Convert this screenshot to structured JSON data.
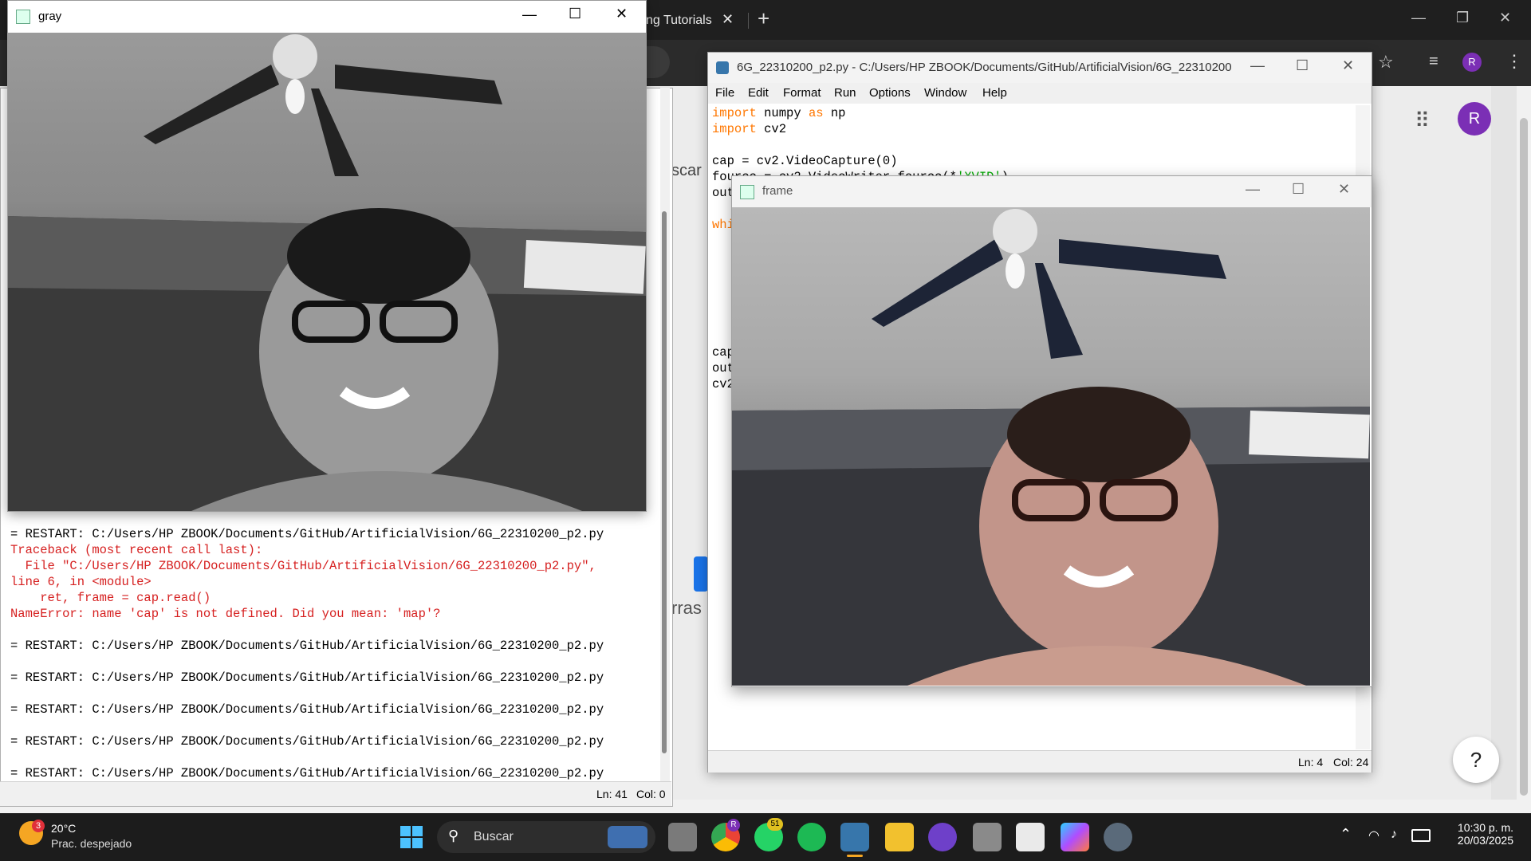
{
  "chrome": {
    "tab_label": "ng Tutorials",
    "avatar_letter": "R",
    "behind_text_1": "scar",
    "behind_text_2": "rras"
  },
  "shell": {
    "restart_line": "= RESTART: C:/Users/HP ZBOOK/Documents/GitHub/ArtificialVision/6G_22310200_p2.py",
    "traceback_lines": [
      "Traceback (most recent call last):",
      "  File \"C:/Users/HP ZBOOK/Documents/GitHub/ArtificialVision/6G_22310200_p2.py\",",
      "line 6, in <module>",
      "    ret, frame = cap.read()",
      "NameError: name 'cap' is not defined. Did you mean: 'map'?"
    ],
    "status_ln": "Ln: 41",
    "status_col": "Col: 0"
  },
  "gray_window": {
    "title": "gray"
  },
  "editor": {
    "title": "6G_22310200_p2.py - C:/Users/HP ZBOOK/Documents/GitHub/ArtificialVision/6G_22310200...",
    "menu": [
      "File",
      "Edit",
      "Format",
      "Run",
      "Options",
      "Window",
      "Help"
    ],
    "code": {
      "l1_kw": "import",
      "l1_rest": " numpy ",
      "l1_kw2": "as",
      "l1_end": " np",
      "l2_kw": "import",
      "l2_rest": " cv2",
      "l4": "cap = cv2.VideoCapture(0)",
      "l5a": "fourcc = cv2.VideoWriter_fourcc(*",
      "l5b": "'XVID'",
      "l5c": ")",
      "l6": "out",
      "l8": "whi",
      "l16": "cap",
      "l17": "out",
      "l18": "cv2"
    },
    "status_ln": "Ln: 4",
    "status_col": "Col: 24"
  },
  "frame_window": {
    "title": "frame"
  },
  "taskbar": {
    "weather_badge": "3",
    "weather_temp": "20°C",
    "weather_desc": "Prac. despejado",
    "search_placeholder": "Buscar",
    "chrome_badge": "R",
    "whatsapp_badge": "51",
    "time": "10:30 p. m.",
    "date": "20/03/2025"
  },
  "colors": {
    "keyword": "#ff7700",
    "string": "#00aa00",
    "error": "#d62020",
    "avatar": "#7b2fb5"
  }
}
